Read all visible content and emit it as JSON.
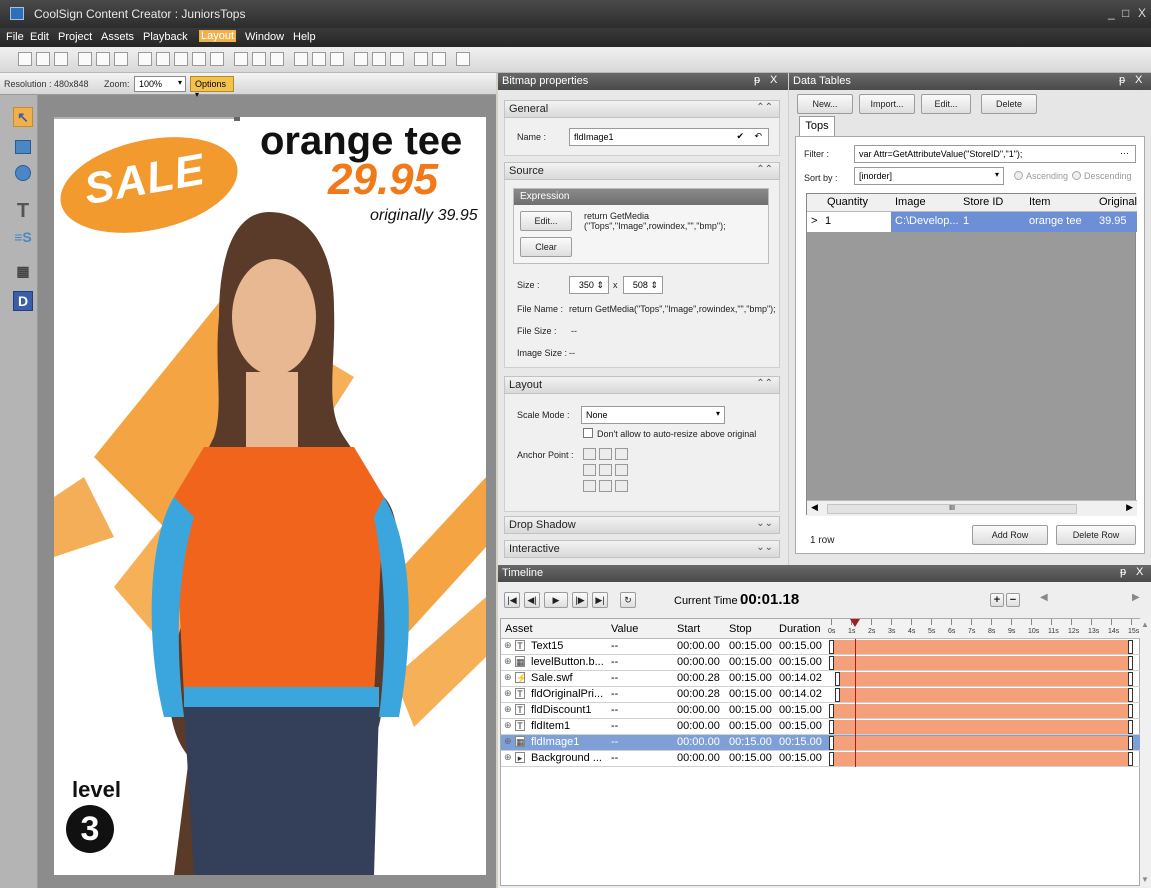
{
  "window": {
    "title": "CoolSign Content Creator : JuniorsTops",
    "min": "_",
    "max": "□",
    "close": "X"
  },
  "menu": [
    "File",
    "Edit",
    "Project",
    "Assets",
    "Playback",
    "Layout",
    "Window",
    "Help"
  ],
  "canvas_bar": {
    "resolution": "Resolution : 480x848",
    "zoom_label": "Zoom:",
    "zoom_value": "100%",
    "options": "Options"
  },
  "poster": {
    "headline": "orange tee",
    "price": "29.95",
    "original": "originally 39.95",
    "badge": "SALE",
    "level": "level",
    "level_num": "3"
  },
  "bitmap_panel": {
    "title": "Bitmap properties",
    "pin": "ᵽ",
    "close": "X",
    "general": {
      "label": "General",
      "name_label": "Name :",
      "name_value": "fldImage1"
    },
    "source": {
      "label": "Source",
      "expression": "Expression",
      "edit": "Edit...",
      "clear": "Clear",
      "expr_text": "return GetMedia\n(\"Tops\",\"Image\",rowindex,\"\",\"bmp\");",
      "size_label": "Size :",
      "w": "350",
      "x": "x",
      "h": "508",
      "filename_label": "File Name :",
      "filename_value": "return GetMedia(\"Tops\",\"Image\",rowindex,\"\",\"bmp\");",
      "filesize_label": "File Size :",
      "filesize_value": "--",
      "imagesize_label": "Image Size :",
      "imagesize_value": "--"
    },
    "layout": {
      "label": "Layout",
      "scale_label": "Scale Mode :",
      "scale_value": "None",
      "autoresize": "Don't allow to auto-resize above original",
      "anchor_label": "Anchor Point :"
    },
    "drop_shadow": "Drop Shadow",
    "interactive": "Interactive"
  },
  "data_tables": {
    "title": "Data Tables",
    "new": "New...",
    "import": "Import...",
    "edit": "Edit...",
    "delete": "Delete",
    "tab": "Tops",
    "filter_label": "Filter :",
    "filter_value": "var Attr=GetAttributeValue(\"StoreID\",\"1\");",
    "filter_more": "···",
    "sortby_label": "Sort by :",
    "sortby_value": "[inorder]",
    "ascending": "Ascending",
    "descending": "Descending",
    "columns": [
      "Quantity",
      "Image",
      "Store ID",
      "Item",
      "Original P"
    ],
    "rows": [
      {
        "marker": ">",
        "values": [
          "1",
          "C:\\Develop...",
          "1",
          "orange tee",
          "39.95"
        ]
      }
    ],
    "row_count": "1 row",
    "add_row": "Add Row",
    "delete_row": "Delete Row",
    "scroll_mid": "III"
  },
  "timeline": {
    "title": "Timeline",
    "pin": "ᵽ",
    "close": "X",
    "current_label": "Current Time :",
    "current_value": "00:01.18",
    "columns": [
      "Asset",
      "Value",
      "Start",
      "Stop",
      "Duration"
    ],
    "ticks": [
      "0s",
      "1s",
      "2s",
      "3s",
      "4s",
      "5s",
      "6s",
      "7s",
      "8s",
      "9s",
      "10s",
      "11s",
      "12s",
      "13s",
      "14s",
      "15s"
    ],
    "playhead_seconds": 1.18,
    "rows": [
      {
        "icon": "T",
        "name": "Text15",
        "value": "--",
        "start": "00:00.00",
        "stop": "00:15.00",
        "duration": "00:15.00",
        "s": 0,
        "e": 15
      },
      {
        "icon": "▦",
        "name": "levelButton.b...",
        "value": "--",
        "start": "00:00.00",
        "stop": "00:15.00",
        "duration": "00:15.00",
        "s": 0,
        "e": 15
      },
      {
        "icon": "⚡",
        "name": "Sale.swf",
        "value": "--",
        "start": "00:00.28",
        "stop": "00:15.00",
        "duration": "00:14.02",
        "s": 0.28,
        "e": 15
      },
      {
        "icon": "T",
        "name": "fldOriginalPri...",
        "value": "--",
        "start": "00:00.28",
        "stop": "00:15.00",
        "duration": "00:14.02",
        "s": 0.28,
        "e": 15
      },
      {
        "icon": "T",
        "name": "fldDiscount1",
        "value": "--",
        "start": "00:00.00",
        "stop": "00:15.00",
        "duration": "00:15.00",
        "s": 0,
        "e": 15
      },
      {
        "icon": "T",
        "name": "fldItem1",
        "value": "--",
        "start": "00:00.00",
        "stop": "00:15.00",
        "duration": "00:15.00",
        "s": 0,
        "e": 15
      },
      {
        "icon": "▦",
        "name": "fldImage1",
        "value": "--",
        "start": "00:00.00",
        "stop": "00:15.00",
        "duration": "00:15.00",
        "s": 0,
        "e": 15,
        "selected": true
      },
      {
        "icon": "▸",
        "name": "Background ...",
        "value": "--",
        "start": "00:00.00",
        "stop": "00:15.00",
        "duration": "00:15.00",
        "s": 0,
        "e": 15
      }
    ]
  }
}
